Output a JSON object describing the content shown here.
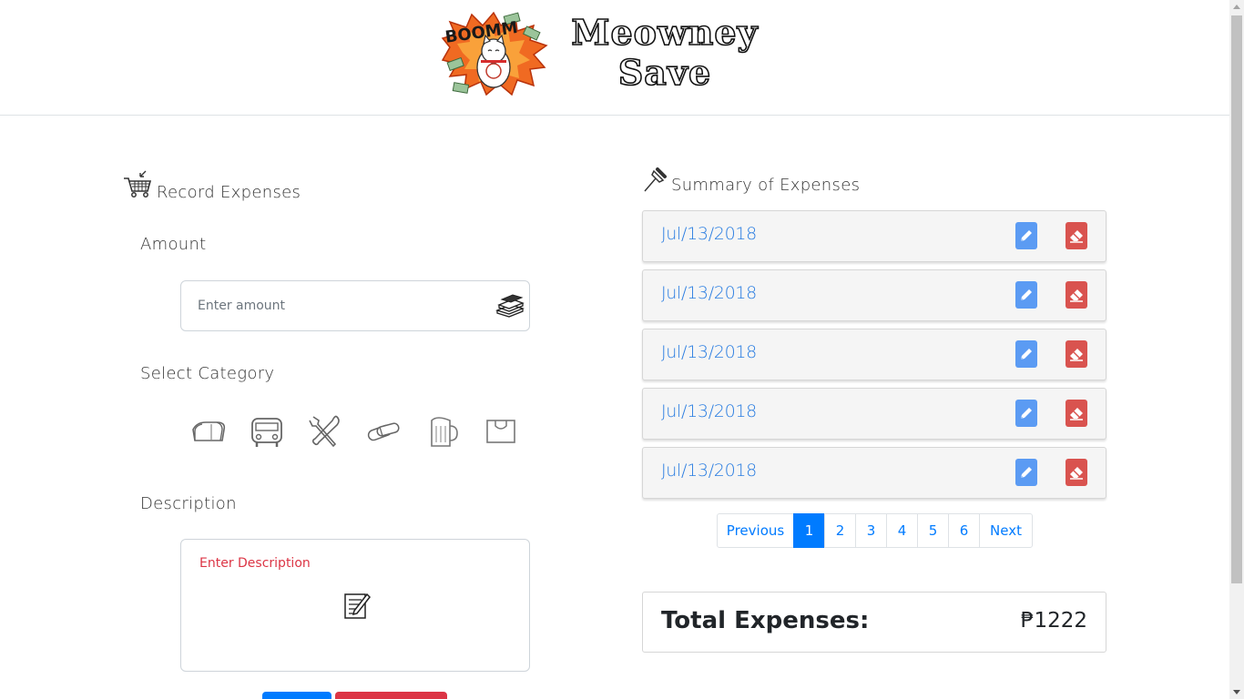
{
  "header": {
    "logo_burst_text": "BOOMM",
    "brand_line1": "Meowney",
    "brand_line2": "Save"
  },
  "record": {
    "title": "Record Expenses",
    "title_icon": "shopping-cart-icon",
    "amount_label": "Amount",
    "amount_placeholder": "Enter amount",
    "amount_icon": "money-stack-icon",
    "category_label": "Select Category",
    "categories": [
      {
        "icon": "bread-icon"
      },
      {
        "icon": "bus-icon"
      },
      {
        "icon": "tools-icon"
      },
      {
        "icon": "pill-icon"
      },
      {
        "icon": "beer-mug-icon"
      },
      {
        "icon": "shopping-bag-icon"
      }
    ],
    "description_label": "Description",
    "description_placeholder": "Enter Description",
    "description_icon": "note-pencil-icon"
  },
  "summary": {
    "title": "Summary of Expenses",
    "title_icon": "pushpin-icon",
    "items": [
      {
        "date": "Jul/13/2018"
      },
      {
        "date": "Jul/13/2018"
      },
      {
        "date": "Jul/13/2018"
      },
      {
        "date": "Jul/13/2018"
      },
      {
        "date": "Jul/13/2018"
      }
    ],
    "pagination": {
      "previous": "Previous",
      "pages": [
        "1",
        "2",
        "3",
        "4",
        "5",
        "6"
      ],
      "active_page": "1",
      "next": "Next"
    },
    "total_label": "Total Expenses:",
    "total_value": "₱1222"
  },
  "colors": {
    "link": "#007bff",
    "date_text": "#2a7de1",
    "edit_button": "#5b9bf3",
    "delete_button": "#d9534f",
    "placeholder_red": "#dc3545"
  }
}
